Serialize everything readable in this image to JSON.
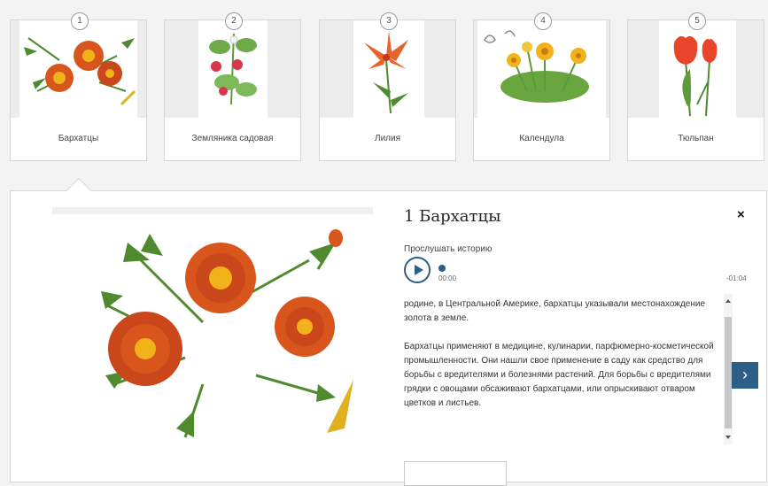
{
  "cards": [
    {
      "number": "1",
      "label": "Бархатцы"
    },
    {
      "number": "2",
      "label": "Земляника садовая"
    },
    {
      "number": "3",
      "label": "Лилия"
    },
    {
      "number": "4",
      "label": "Календула"
    },
    {
      "number": "5",
      "label": "Тюльпан"
    }
  ],
  "detail": {
    "title": "1 Бархатцы",
    "close_label": "×",
    "listen_label": "Прослушать историю",
    "time_current": "00:00",
    "time_remaining": "-01:04",
    "paragraphs": [
      "родине, в Центральной Америке, бархатцы указывали местонахождение золота в земле.",
      "Бархатцы применяют в медицине, кулинарии, парфюмерно-косметической промышленности. Они нашли свое применение в саду как средство для борьбы с вредителями и болезнями растений. Для борьбы с вредителями грядки с овощами обсаживают бархатцами, или опрыскивают отваром цветков и листьев."
    ],
    "next_label": "›"
  },
  "icons": {
    "play": "play-icon",
    "next": "chevron-right-icon",
    "close": "close-icon"
  },
  "colors": {
    "accent": "#2b5f86",
    "marigold_orange": "#d8551c",
    "leaf_green": "#4f8a2e"
  }
}
